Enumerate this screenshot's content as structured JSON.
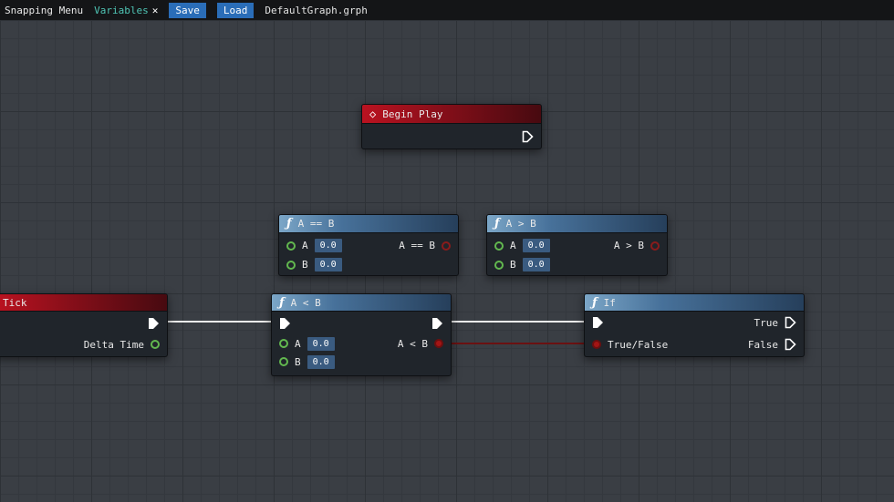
{
  "toolbar": {
    "menu_label": "Snapping Menu",
    "variables_tab": {
      "label": "Variables",
      "close": "✕"
    },
    "save_label": "Save",
    "load_label": "Load",
    "filename": "DefaultGraph.grph"
  },
  "icons": {
    "function": "ƒ",
    "event": "◇"
  },
  "colors": {
    "event_header": "#b01220",
    "function_header": "#5b87ab",
    "exec_pin": "#ffffff",
    "number_pin": "#62b84f",
    "bool_pin": "#a31515",
    "wire_exec": "#ececec",
    "wire_bool": "#6b1111",
    "toolbar_button": "#2a6db8",
    "variables_text": "#4fc4b4"
  },
  "nodes": {
    "begin_play": {
      "title": "Begin Play"
    },
    "a_eq_b": {
      "title": "A == B",
      "inputs": [
        {
          "label": "A",
          "value": "0.0"
        },
        {
          "label": "B",
          "value": "0.0"
        }
      ],
      "output_label": "A == B"
    },
    "a_gt_b": {
      "title": "A > B",
      "inputs": [
        {
          "label": "A",
          "value": "0.0"
        },
        {
          "label": "B",
          "value": "0.0"
        }
      ],
      "output_label": "A > B"
    },
    "tick": {
      "title": "Tick",
      "output_label": "Delta Time"
    },
    "a_lt_b": {
      "title": "A < B",
      "inputs": [
        {
          "label": "A",
          "value": "0.0"
        },
        {
          "label": "B",
          "value": "0.0"
        }
      ],
      "output_label": "A < B"
    },
    "if_node": {
      "title": "If",
      "input_label": "True/False",
      "outputs": [
        {
          "label": "True"
        },
        {
          "label": "False"
        }
      ]
    }
  }
}
